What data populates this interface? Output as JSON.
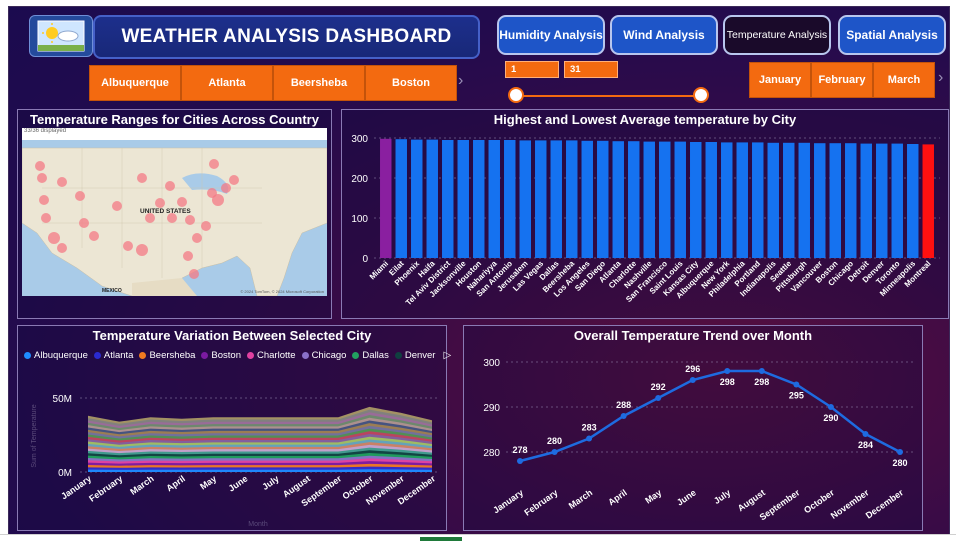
{
  "header": {
    "title": "WEATHER ANALYSIS DASHBOARD",
    "nav": [
      {
        "label": "Humidity Analysis",
        "active": false
      },
      {
        "label": "Wind Analysis",
        "active": false
      },
      {
        "label": "Temperature Analysis",
        "active": true
      },
      {
        "label": "Spatial Analysis",
        "active": false
      }
    ]
  },
  "city_slicer": [
    "Albuquerque",
    "Atlanta",
    "Beersheba",
    "Boston"
  ],
  "day_range": {
    "min": "1",
    "max": "31"
  },
  "month_slicer": [
    "January",
    "February",
    "March"
  ],
  "colors": {
    "accent_orange": "#f36a10",
    "bar_blue": "#1572f0",
    "bar_highest": "#8a1fa0",
    "bar_lowest": "#ff1010",
    "trend_line": "#1e6be0"
  },
  "map_panel": {
    "title": "Temperature Ranges for Cities Across Country",
    "header_text": "33/36 displayed",
    "country_label": "UNITED STATES",
    "mexico_label": "MEXICO",
    "credit": "© 2024 TomTom, © 2024 Microsoft Corporation"
  },
  "chart_data": [
    {
      "type": "bar",
      "title": "Highest and Lowest Average temperature by City",
      "categories": [
        "Miami",
        "Eilat",
        "Phoenix",
        "Haifa",
        "Tel Aviv District",
        "Jacksonville",
        "Houston",
        "Nahariyya",
        "San Antonio",
        "Jerusalem",
        "Las Vegas",
        "Dallas",
        "Beersheba",
        "Los Angeles",
        "San Diego",
        "Atlanta",
        "Charlotte",
        "Nashville",
        "San Francisco",
        "Saint Louis",
        "Kansas City",
        "Albuquerque",
        "New York",
        "Philadelphia",
        "Portland",
        "Indianapolis",
        "Seattle",
        "Pittsburgh",
        "Vancouver",
        "Boston",
        "Chicago",
        "Detroit",
        "Denver",
        "Toronto",
        "Minneapolis",
        "Montreal"
      ],
      "values": [
        298,
        297,
        296,
        296,
        295,
        295,
        295,
        295,
        295,
        294,
        294,
        294,
        294,
        293,
        293,
        292,
        292,
        291,
        291,
        291,
        290,
        290,
        289,
        289,
        289,
        288,
        288,
        288,
        287,
        287,
        287,
        286,
        286,
        286,
        285,
        284
      ],
      "ylim": [
        0,
        300
      ],
      "yticks": [
        0,
        100,
        200,
        300
      ]
    },
    {
      "type": "area",
      "title": "Temperature Variation Between Selected City",
      "legend": [
        "Albuquerque",
        "Atlanta",
        "Beersheba",
        "Boston",
        "Charlotte",
        "Chicago",
        "Dallas",
        "Denver"
      ],
      "legend_colors": [
        "#1e8cff",
        "#2a2ad0",
        "#f07a20",
        "#7a1aa0",
        "#e040a0",
        "#8a70c8",
        "#22a060",
        "#104040"
      ],
      "categories": [
        "January",
        "February",
        "March",
        "April",
        "May",
        "June",
        "July",
        "August",
        "September",
        "October",
        "November",
        "December"
      ],
      "totals": [
        38,
        34,
        37,
        36,
        37,
        37,
        37,
        37,
        37,
        44,
        40,
        35
      ],
      "ytick_labels": [
        "0M",
        "50M"
      ],
      "ylabel": "Sum of Temperature",
      "xlabel": "Month"
    },
    {
      "type": "line",
      "title": "Overall Temperature Trend over Month",
      "categories": [
        "January",
        "February",
        "March",
        "April",
        "May",
        "June",
        "July",
        "August",
        "September",
        "October",
        "November",
        "December"
      ],
      "values": [
        278,
        280,
        283,
        288,
        292,
        296,
        298,
        298,
        295,
        290,
        284,
        280
      ],
      "value_labels": [
        "278",
        "280",
        "283",
        "288",
        "292",
        "296",
        "298",
        "298",
        "295",
        "290",
        "284",
        "280"
      ],
      "ylim": [
        276,
        300
      ],
      "yticks": [
        280,
        290,
        300
      ]
    }
  ]
}
